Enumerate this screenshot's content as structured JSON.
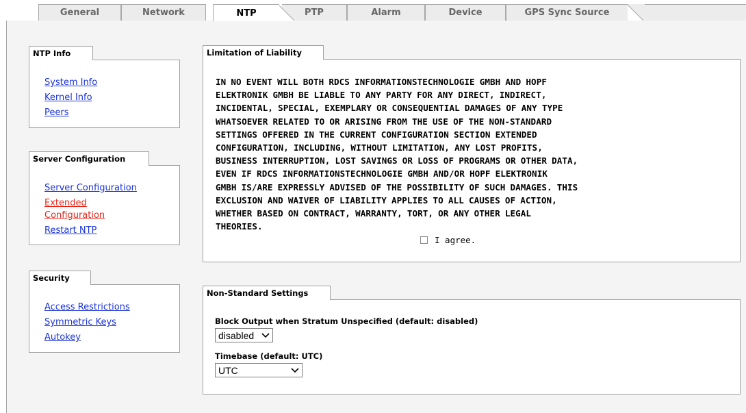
{
  "tabs": [
    {
      "label": "General"
    },
    {
      "label": "Network"
    },
    {
      "label": "NTP"
    },
    {
      "label": "PTP"
    },
    {
      "label": "Alarm"
    },
    {
      "label": "Device"
    },
    {
      "label": "GPS Sync Source"
    }
  ],
  "active_tab": "NTP",
  "ntp_info": {
    "title": "NTP Info",
    "links": [
      "System Info",
      "Kernel Info",
      "Peers"
    ]
  },
  "server_config": {
    "title": "Server Configuration",
    "links": [
      "Server Configuration",
      "Extended Configuration",
      "Restart NTP"
    ],
    "active_link": "Extended Configuration"
  },
  "security": {
    "title": "Security",
    "links": [
      "Access Restrictions",
      "Symmetric Keys",
      "Autokey"
    ]
  },
  "liability": {
    "title": "Limitation of Liability",
    "lines": [
      "IN NO EVENT WILL BOTH RDCS INFORMATIONSTECHNOLOGIE GMBH AND HOPF",
      "ELEKTRONIK GMBH BE LIABLE TO ANY PARTY FOR ANY DIRECT, INDIRECT,",
      "INCIDENTAL, SPECIAL, EXEMPLARY OR CONSEQUENTIAL DAMAGES OF ANY TYPE",
      "WHATSOEVER RELATED TO OR ARISING FROM THE USE OF THE NON-STANDARD",
      "SETTINGS OFFERED IN THE CURRENT CONFIGURATION SECTION EXTENDED",
      "CONFIGURATION, INCLUDING, WITHOUT LIMITATION, ANY LOST PROFITS,",
      "BUSINESS INTERRUPTION, LOST SAVINGS OR LOSS OF PROGRAMS OR OTHER DATA,",
      "EVEN IF RDCS INFORMATIONSTECHNOLOGIE GMBH AND/OR HOPF ELEKTRONIK",
      "GMBH IS/ARE EXPRESSLY ADVISED OF THE POSSIBILITY OF SUCH DAMAGES. THIS",
      "EXCLUSION AND WAIVER OF LIABILITY APPLIES TO ALL CAUSES OF ACTION,",
      "WHETHER BASED ON CONTRACT, WARRANTY, TORT, OR ANY OTHER LEGAL",
      "THEORIES."
    ],
    "agree_label": "I agree.",
    "agree_checked": false
  },
  "non_standard": {
    "title": "Non-Standard Settings",
    "block_output_label": "Block Output when Stratum Unspecified (default: disabled)",
    "block_output_value": "disabled",
    "timebase_label": "Timebase (default: UTC)",
    "timebase_value": "UTC"
  },
  "colors": {
    "link": "#1a33d8",
    "link_active": "#e8261a",
    "panel_border": "#a0a0a0",
    "content_bg": "#f4f4f4"
  }
}
